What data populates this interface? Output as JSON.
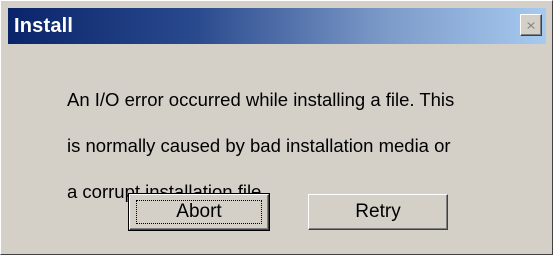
{
  "window": {
    "title": "Install",
    "close_icon": "close-icon"
  },
  "message": {
    "lines": [
      "An I/O error occurred while installing a file. This",
      "is normally caused by bad installation media or",
      "a corrupt installation file."
    ]
  },
  "buttons": {
    "abort_label": "Abort",
    "retry_label": "Retry"
  },
  "colors": {
    "titlebar_start": "#0a246a",
    "titlebar_end": "#a6caf0",
    "face": "#d4d0c8"
  }
}
